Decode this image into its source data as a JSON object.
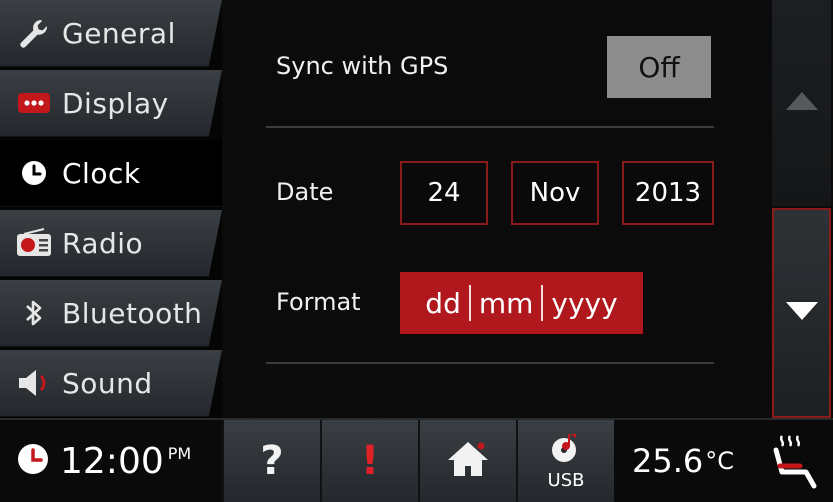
{
  "sidebar": {
    "items": [
      {
        "label": "General",
        "icon": "wrench-icon"
      },
      {
        "label": "Display",
        "icon": "display-dots-icon"
      },
      {
        "label": "Clock",
        "icon": "clock-icon"
      },
      {
        "label": "Radio",
        "icon": "radio-icon"
      },
      {
        "label": "Bluetooth",
        "icon": "bluetooth-icon"
      },
      {
        "label": "Sound",
        "icon": "speaker-icon"
      }
    ],
    "active_index": 2
  },
  "clock_settings": {
    "gps_label": "Sync with GPS",
    "gps_value": "Off",
    "date_label": "Date",
    "date_day": "24",
    "date_month": "Nov",
    "date_year": "2013",
    "format_label": "Format",
    "format_parts": [
      "dd",
      "mm",
      "yyyy"
    ]
  },
  "scroll": {
    "up_icon": "scroll-up-arrow-icon",
    "down_icon": "scroll-down-arrow-icon"
  },
  "status_bar": {
    "time": "12:00",
    "ampm": "PM",
    "help_glyph": "?",
    "alert_glyph": "!",
    "usb_label": "USB",
    "temperature": "25.6",
    "temp_unit": "°C"
  },
  "colors": {
    "accent_red": "#b0181d",
    "border_red": "#8b1a1a",
    "gps_off_bg": "#8d8d8d"
  }
}
